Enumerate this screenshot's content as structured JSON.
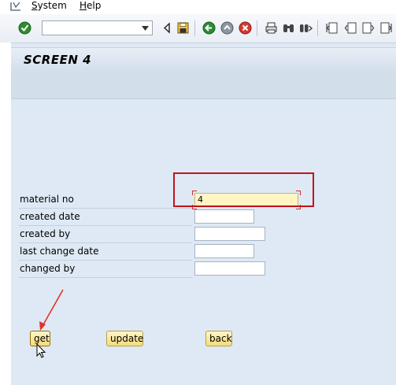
{
  "menu": {
    "system_first": "S",
    "system_rest": "ystem",
    "help_first": "H",
    "help_rest": "elp"
  },
  "toolbar": {
    "command_value": ""
  },
  "screen": {
    "title": "SCREEN 4"
  },
  "form": {
    "fields": [
      {
        "label": "material no",
        "value": "4"
      },
      {
        "label": "created date",
        "value": ""
      },
      {
        "label": "created by",
        "value": ""
      },
      {
        "label": "last change date",
        "value": ""
      },
      {
        "label": "changed by",
        "value": ""
      }
    ]
  },
  "buttons": {
    "get": "get",
    "update": "update",
    "back": "back"
  },
  "colors": {
    "annotation": "#c0141c",
    "button_fill": "#f5dc7a",
    "active_field": "#fff6c4"
  },
  "icons": {
    "app": "sap-logo-icon",
    "enter": "green-check-icon",
    "back_nav": "back-triangle-icon",
    "save": "floppy-disk-icon",
    "back": "green-back-icon",
    "exit": "exit-icon",
    "cancel": "cancel-icon",
    "print": "printer-icon",
    "find": "binoculars-icon",
    "find_next": "find-next-icon",
    "first_page": "first-page-icon",
    "prev_page": "prev-page-icon",
    "next_page": "next-page-icon",
    "last_page": "last-page-icon"
  }
}
